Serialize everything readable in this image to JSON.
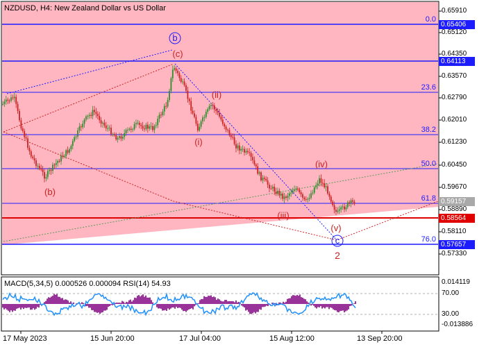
{
  "header": {
    "symbol_title": "NZDUSD, H4:  New Zealand Dollar vs US Dollar",
    "indicator_title": "MACD(5,34,5) 0.000526 0.000094 RSI(14) 54.93"
  },
  "price_axis": {
    "ticks": [
      "0.65910",
      "0.65120",
      "0.64350",
      "0.63570",
      "0.62790",
      "0.62010",
      "0.61230",
      "0.60450",
      "0.59670",
      "0.58890",
      "0.58110",
      "0.57330"
    ],
    "tags": [
      {
        "label": "0.65406",
        "color": "#1c1cff"
      },
      {
        "label": "0.64113",
        "color": "#1c1cff"
      },
      {
        "label": "0.59157",
        "color": "#a9a9a9"
      },
      {
        "label": "0.58564",
        "color": "#e00000"
      },
      {
        "label": "0.57657",
        "color": "#1c1cff"
      }
    ]
  },
  "indicator_axis": {
    "ticks": [
      "0.014119",
      "70.00",
      "30.00",
      "-0.013886"
    ]
  },
  "time_axis": [
    "17 May 2023",
    "15 Jun 20:00",
    "17 Jul 04:00",
    "15 Aug 12:00",
    "13 Sep 20:00"
  ],
  "fib_levels": [
    "0.0",
    "23.6",
    "38.2",
    "50.0",
    "61.8",
    "76.0"
  ],
  "wave_labels": {
    "b_circle": "b",
    "c_paren": "(c)",
    "ii": "(ii)",
    "i": "(i)",
    "b_paren": "(b)",
    "iv": "(iv)",
    "iii": "(iii)",
    "v": "(v)",
    "c_circle": "c",
    "wave_2": "2"
  },
  "colors": {
    "pink_zone": "#ffb6c1",
    "fib_line": "#1c1cff",
    "support_line": "#e00000",
    "bull_candle": "#2e8b2e",
    "bear_candle": "#cc2222",
    "macd_hist": "#800080",
    "rsi_line": "#1e90ff",
    "wave_label": "#cc2222"
  }
}
